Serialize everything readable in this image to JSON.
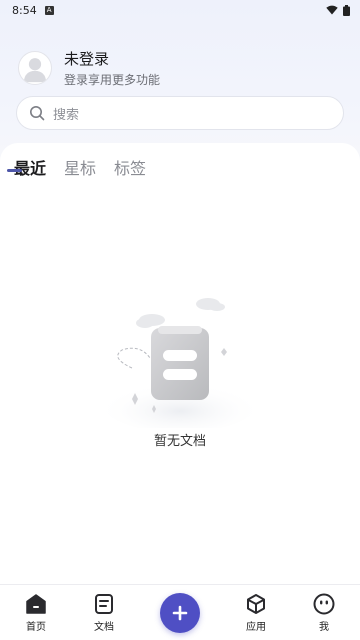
{
  "status_bar": {
    "time": "8:54",
    "app_badge": "A"
  },
  "profile": {
    "name": "未登录",
    "subtitle": "登录享用更多功能"
  },
  "search": {
    "placeholder": "搜索"
  },
  "tabs": [
    {
      "label": "最近",
      "active": true
    },
    {
      "label": "星标",
      "active": false
    },
    {
      "label": "标签",
      "active": false
    }
  ],
  "empty_state": {
    "text": "暂无文档"
  },
  "bottom_nav": {
    "items": [
      {
        "label": "首页",
        "icon": "home-icon",
        "active": true
      },
      {
        "label": "文档",
        "icon": "document-icon"
      },
      {
        "label": "",
        "icon": "plus-icon"
      },
      {
        "label": "应用",
        "icon": "cube-icon"
      },
      {
        "label": "我",
        "icon": "face-icon"
      }
    ]
  },
  "colors": {
    "accent": "#4d56a8",
    "fab": "#4f4fc4",
    "background_top": "#eef1fb"
  }
}
